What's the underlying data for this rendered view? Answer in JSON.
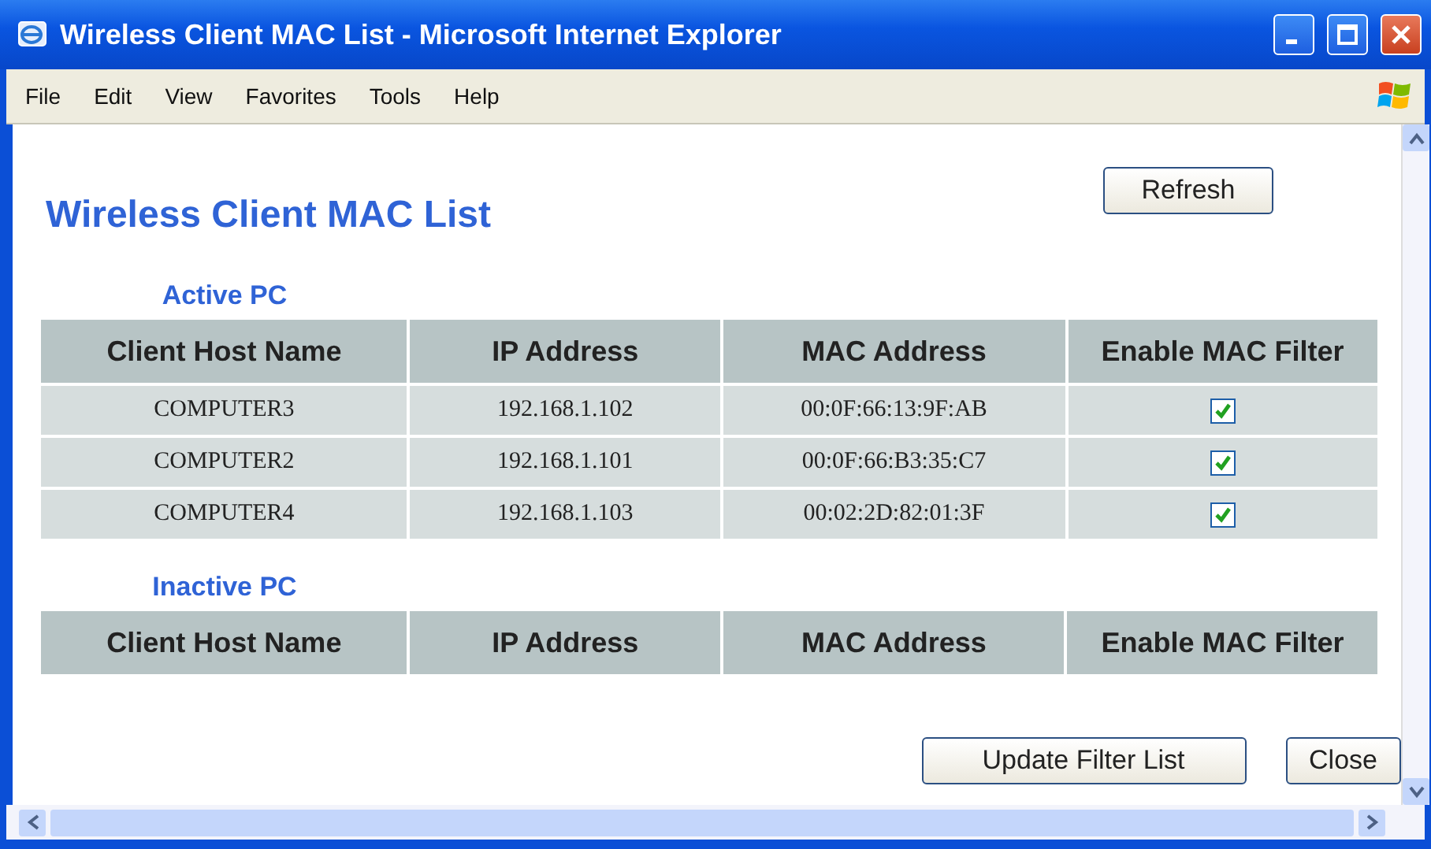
{
  "window": {
    "title": "Wireless Client MAC List - Microsoft Internet Explorer",
    "menu": [
      "File",
      "Edit",
      "View",
      "Favorites",
      "Tools",
      "Help"
    ]
  },
  "page": {
    "heading": "Wireless Client MAC List",
    "refresh_button": "Refresh",
    "sections": [
      {
        "label": "Active PC",
        "columns": [
          "Client Host Name",
          "IP Address",
          "MAC Address",
          "Enable MAC Filter"
        ],
        "rows": [
          {
            "client_host_name": "COMPUTER3",
            "ip_address": "192.168.1.102",
            "mac_address": "00:0F:66:13:9F:AB",
            "enable_mac_filter": true
          },
          {
            "client_host_name": "COMPUTER2",
            "ip_address": "192.168.1.101",
            "mac_address": "00:0F:66:B3:35:C7",
            "enable_mac_filter": true
          },
          {
            "client_host_name": "COMPUTER4",
            "ip_address": "192.168.1.103",
            "mac_address": "00:02:2D:82:01:3F",
            "enable_mac_filter": true
          }
        ]
      },
      {
        "label": "Inactive PC",
        "columns": [
          "Client Host Name",
          "IP Address",
          "MAC Address",
          "Enable MAC Filter"
        ]
      }
    ],
    "buttons": [
      "Update Filter List",
      "Close"
    ]
  }
}
